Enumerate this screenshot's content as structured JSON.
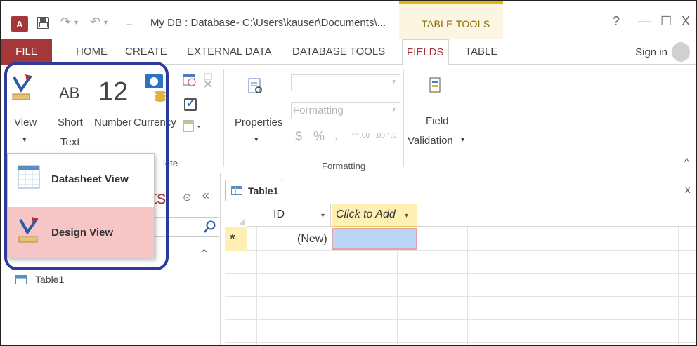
{
  "titlebar": {
    "app_icon_letter": "A",
    "title": "My DB : Database- C:\\Users\\kauser\\Documents\\...",
    "context_tab_group": "TABLE TOOLS",
    "help": "?",
    "minimize": "—",
    "maximize": "☐",
    "close": "X"
  },
  "tabs": {
    "file": "FILE",
    "home": "HOME",
    "create": "CREATE",
    "external_data": "EXTERNAL DATA",
    "database_tools": "DATABASE TOOLS",
    "fields": "FIELDS",
    "table": "TABLE",
    "signin": "Sign in"
  },
  "ribbon": {
    "view_label": "View",
    "view_arrow": "▾",
    "short_text_icon": "AB",
    "short_text_line1": "Short",
    "short_text_line2": "Text",
    "number_icon": "12",
    "number_label": "Number",
    "currency_label": "Currency",
    "properties_label": "Properties",
    "properties_arrow": "▾",
    "formatting_placeholder": "Formatting",
    "format_dollar": "$",
    "format_percent": "%",
    "format_comma": ",",
    "format_inc_decimals": "⁺⁰ .00",
    "format_dec_decimals": ".00 ⁺.0",
    "formatting_group": "Formatting",
    "field_line1": "Field",
    "field_line2": "Validation",
    "field_arrow": "▾",
    "collapse": "^",
    "group_partial": "lete"
  },
  "view_menu": {
    "datasheet_view": "Datasheet View",
    "design_view": "Design View"
  },
  "nav": {
    "title_partial": "ts",
    "collapse_chevrons": "«",
    "dropdown_glyph": "⊙",
    "search_icon": "search-icon",
    "section_chevron": "⌃",
    "tables_item": "Table1"
  },
  "datasheet": {
    "tab_label": "Table1",
    "close": "x",
    "col_id": "ID",
    "col_add": "Click to Add",
    "col_arrow": "▾",
    "new_row_marker": "*",
    "new_cell": "(New)"
  },
  "colors": {
    "access_red": "#a4373a",
    "context_gold": "#e6b800",
    "highlight_ring": "#2c3a9c",
    "selection_pink": "#f6c6c6",
    "new_row_yellow": "#fdf0b2",
    "active_cell_blue": "#b9d6f7"
  }
}
